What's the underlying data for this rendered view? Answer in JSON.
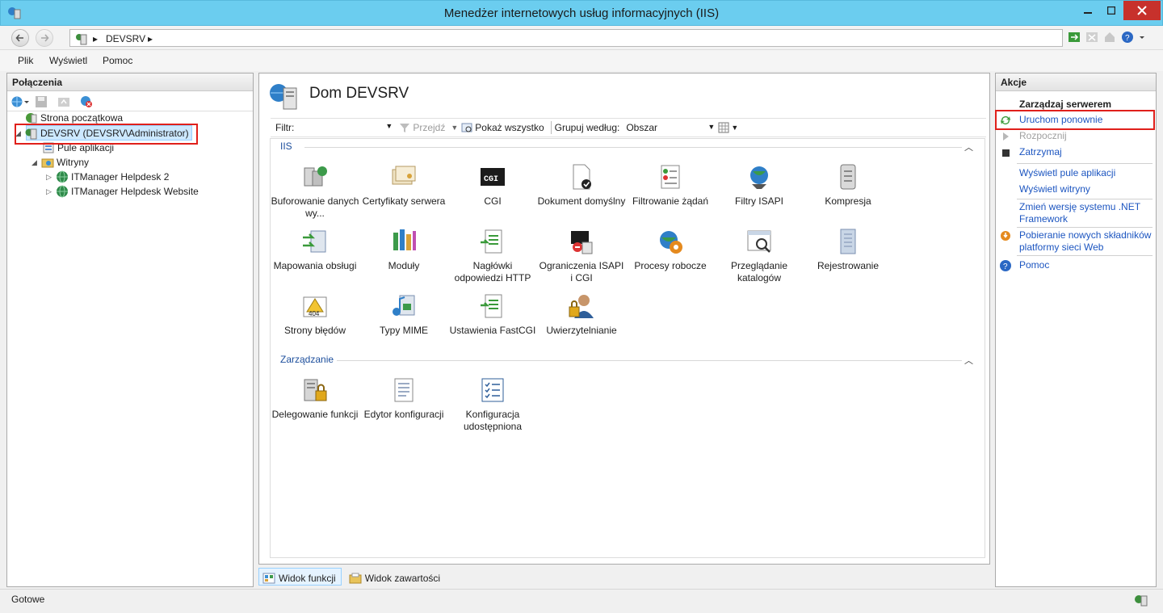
{
  "window": {
    "title": "Menedżer internetowych usług informacyjnych (IIS)",
    "accent_color": "#6bcdef",
    "close_color": "#c7312c"
  },
  "address": {
    "crumbs": [
      "DEVSRV"
    ]
  },
  "menu": {
    "items": [
      "Plik",
      "Wyświetl",
      "Pomoc"
    ]
  },
  "connections": {
    "title": "Połączenia",
    "tree": {
      "start_page": "Strona początkowa",
      "server": "DEVSRV (DEVSRV\\Administrator)",
      "app_pools": "Pule aplikacji",
      "sites": "Witryny",
      "site_1": "ITManager Helpdesk 2",
      "site_2": "ITManager Helpdesk Website"
    }
  },
  "center": {
    "title": "Dom DEVSRV",
    "filter_label": "Filtr:",
    "go_label": "Przejdź",
    "show_all_label": "Pokaż wszystko",
    "group_by_label": "Grupuj według:",
    "group_by_value": "Obszar",
    "groups": {
      "iis": "IIS",
      "management": "Zarządzanie"
    },
    "features": {
      "f1": "Buforowanie danych wy...",
      "f2": "Certyfikaty serwera",
      "f3": "CGI",
      "f4": "Dokument domyślny",
      "f5": "Filtrowanie żądań",
      "f6": "Filtry ISAPI",
      "f7": "Kompresja",
      "f8": "Mapowania obsługi",
      "f9": "Moduły",
      "f10": "Nagłówki odpowiedzi HTTP",
      "f11": "Ograniczenia ISAPI i CGI",
      "f12": "Procesy robocze",
      "f13": "Przeglądanie katalogów",
      "f14": "Rejestrowanie",
      "f15": "Strony błędów",
      "f16": "Typy MIME",
      "f17": "Ustawienia FastCGI",
      "f18": "Uwierzytelnianie",
      "m1": "Delegowanie funkcji",
      "m2": "Edytor konfiguracji",
      "m3": "Konfiguracja udostępniona"
    },
    "cgi_icon_text": "CGI",
    "error_icon_text": "404"
  },
  "view_tabs": {
    "features_view": "Widok funkcji",
    "content_view": "Widok zawartości"
  },
  "actions": {
    "title": "Akcje",
    "section": "Zarządzaj serwerem",
    "restart": "Uruchom ponownie",
    "start": "Rozpocznij",
    "stop": "Zatrzymaj",
    "view_pools": "Wyświetl pule aplikacji",
    "view_sites": "Wyświetl witryny",
    "change_net": "Zmień wersję systemu .NET Framework",
    "get_components": "Pobieranie nowych składników platformy sieci Web",
    "help": "Pomoc"
  },
  "status": {
    "text": "Gotowe"
  }
}
